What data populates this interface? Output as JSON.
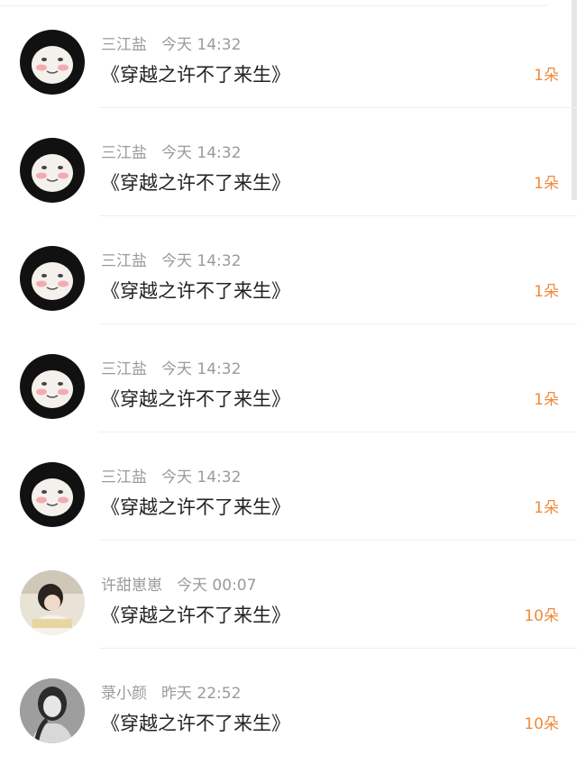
{
  "items": [
    {
      "avatar": "panda-meme-avatar",
      "name": "三江盐",
      "time": "今天 14:32",
      "title": "《穿越之许不了来生》",
      "amount": "1朵"
    },
    {
      "avatar": "panda-meme-avatar",
      "name": "三江盐",
      "time": "今天 14:32",
      "title": "《穿越之许不了来生》",
      "amount": "1朵"
    },
    {
      "avatar": "panda-meme-avatar",
      "name": "三江盐",
      "time": "今天 14:32",
      "title": "《穿越之许不了来生》",
      "amount": "1朵"
    },
    {
      "avatar": "panda-meme-avatar",
      "name": "三江盐",
      "time": "今天 14:32",
      "title": "《穿越之许不了来生》",
      "amount": "1朵"
    },
    {
      "avatar": "panda-meme-avatar",
      "name": "三江盐",
      "time": "今天 14:32",
      "title": "《穿越之许不了来生》",
      "amount": "1朵"
    },
    {
      "avatar": "girl-photo-avatar",
      "name": "许甜崽崽",
      "time": "今天 00:07",
      "title": "《穿越之许不了来生》",
      "amount": "10朵"
    },
    {
      "avatar": "girl-photo-avatar-2",
      "name": "菉小颜",
      "time": "昨天 22:52",
      "title": "《穿越之许不了来生》",
      "amount": "10朵"
    }
  ],
  "colors": {
    "name_gray": "#9a9a9a",
    "title": "#222222",
    "amount_orange": "#f08a3c"
  }
}
